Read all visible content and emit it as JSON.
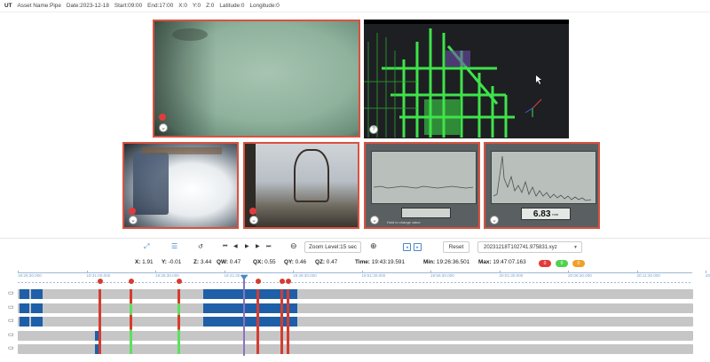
{
  "header": {
    "brand": "UT",
    "asset": "Asset Name:Pipe",
    "date": "Date:2023-12-18",
    "start": "Start:09:00",
    "end": "End:17:00",
    "x0": "X:0",
    "y0": "Y:0",
    "z0": "Z:0",
    "latitude": "Latitude:0",
    "longitude": "Longitude:0"
  },
  "panels": {
    "gauge_left_line1": "Hold to change value",
    "gauge_right_value": "6.83",
    "gauge_right_unit": "mm"
  },
  "controls": {
    "zoom_label": "Zoom Level:15 sec",
    "reset_label": "Reset",
    "file_name": "20231218T102741.975831.xyz"
  },
  "stats": {
    "x_label": "X:",
    "x_value": "1.91",
    "y_label": "Y:",
    "y_value": "-0.01",
    "z_label": "Z:",
    "z_value": "3.44",
    "qw_label": "QW:",
    "qw_value": "0.47",
    "qx_label": "QX:",
    "qx_value": "0.55",
    "qy_label": "QY:",
    "qy_value": "0.46",
    "qz_label": "QZ:",
    "qz_value": "0.47",
    "time_label": "Time:",
    "time_value": "19:43:19.591",
    "min_label": "Min:",
    "min_value": "19:26:36.501",
    "max_label": "Max:",
    "max_value": "19:47:07.163",
    "pill_red": "0",
    "pill_green": "0",
    "pill_orange": "0"
  },
  "timeline": {
    "ticks": [
      "19:26:30.000",
      "19:31:00.000",
      "19:36:30.000",
      "19:41:30.000",
      "19:46:30.000",
      "19:51:30.000",
      "19:56:30.000",
      "20:01:30.000",
      "20:06:30.000",
      "20:11:30.000",
      "20:16:3"
    ],
    "colors": {
      "blue": "#1e5fa8",
      "red": "#d63b2f",
      "green": "#5ee05e",
      "purple": "#8a72c2",
      "track": "#c6c6c6"
    }
  }
}
